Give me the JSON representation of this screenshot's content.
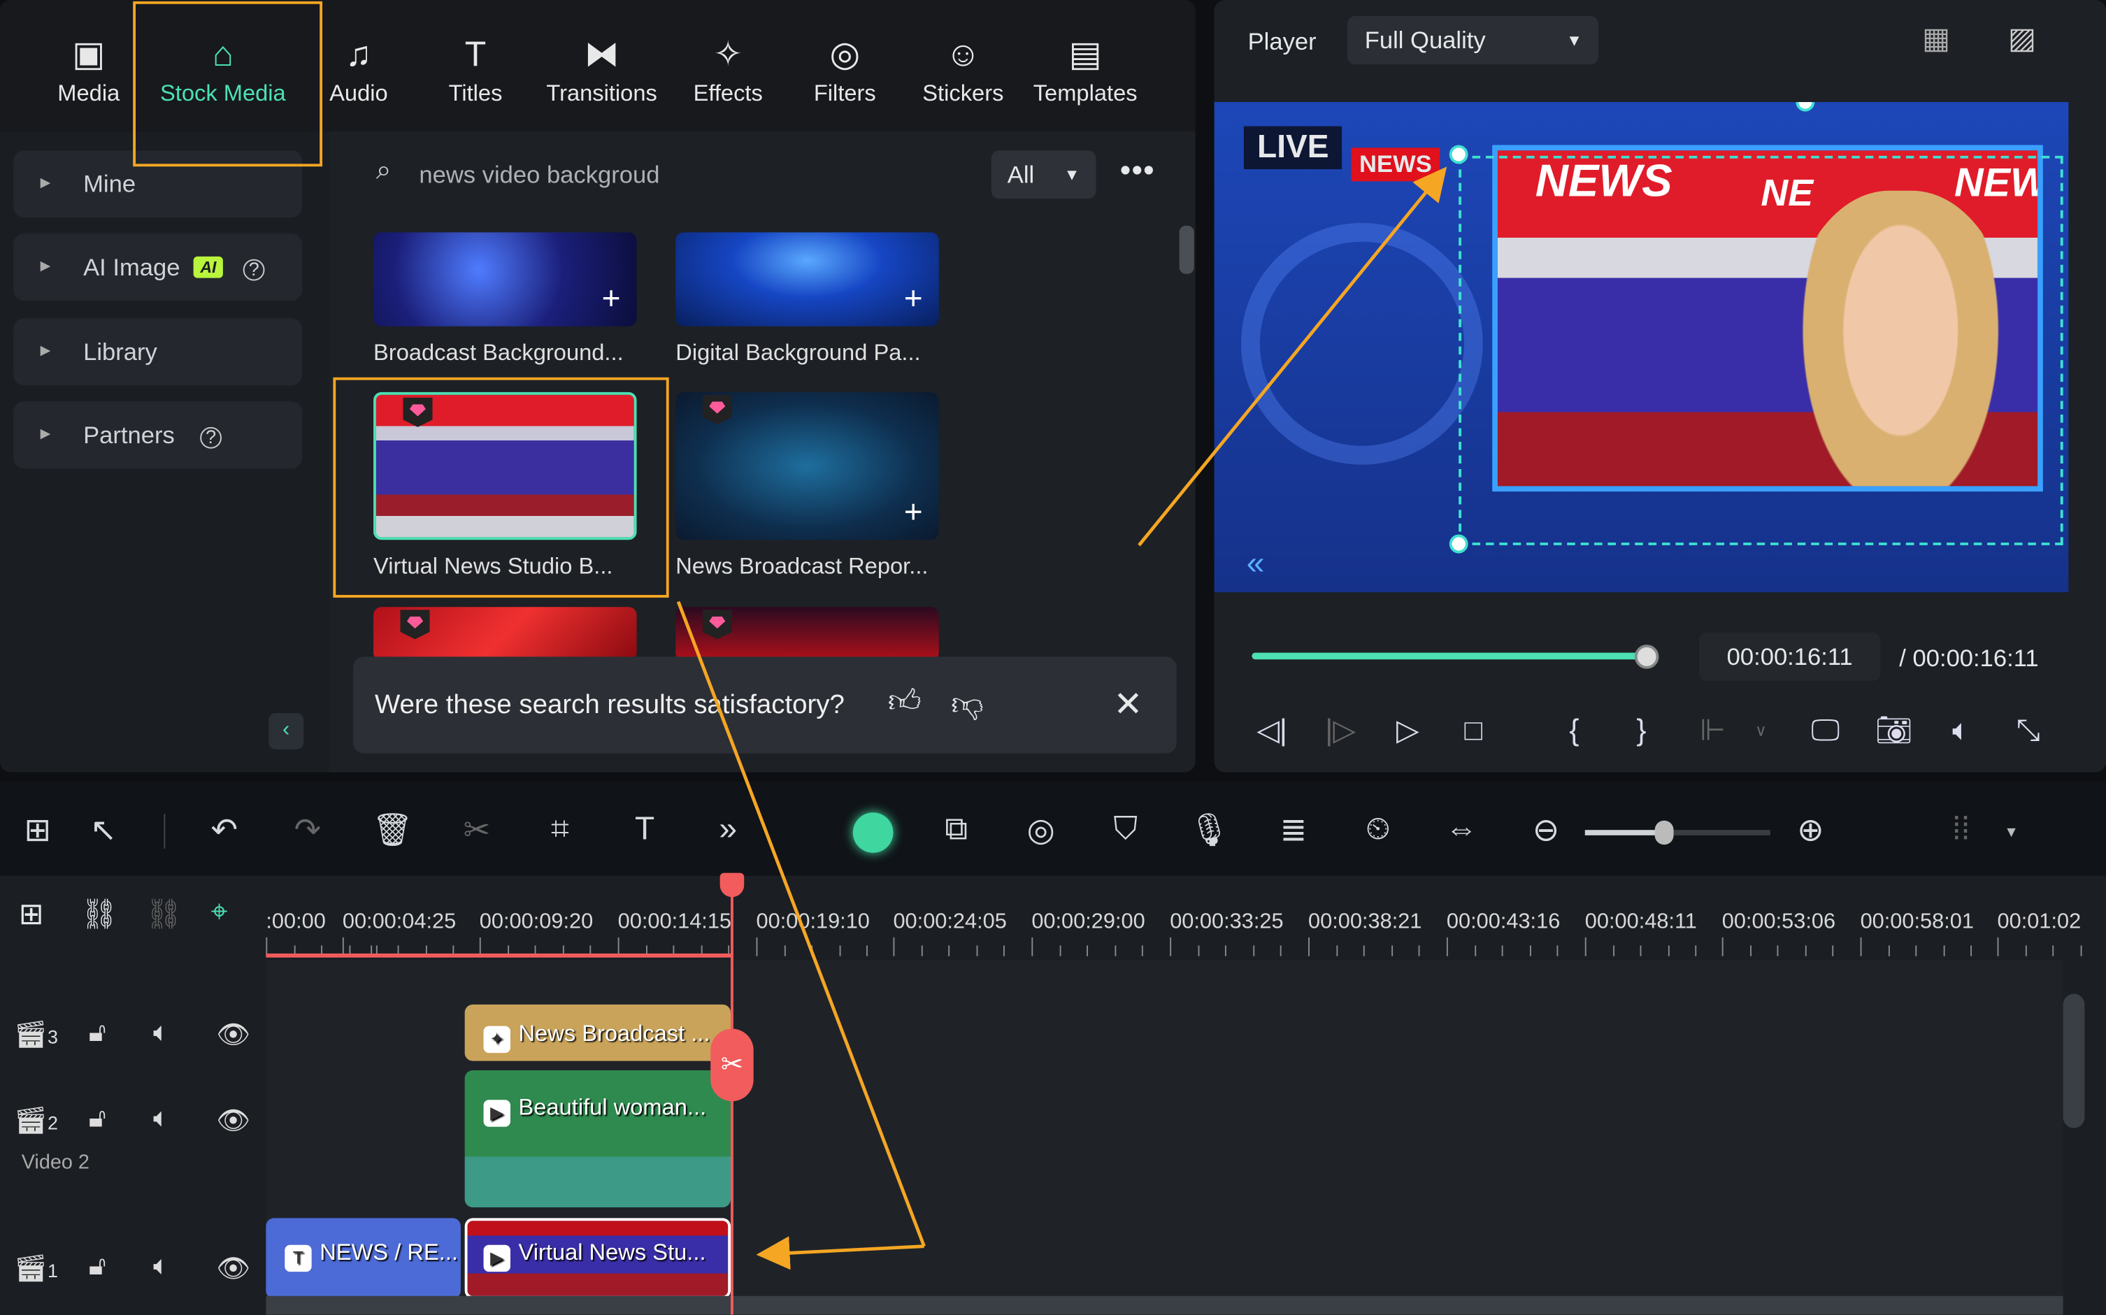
{
  "tabs": [
    {
      "label": "Media",
      "icon": "media-icon"
    },
    {
      "label": "Stock Media",
      "icon": "stock-media-icon",
      "active": true
    },
    {
      "label": "Audio",
      "icon": "music-note-icon"
    },
    {
      "label": "Titles",
      "icon": "text-icon"
    },
    {
      "label": "Transitions",
      "icon": "transitions-icon"
    },
    {
      "label": "Effects",
      "icon": "effects-icon"
    },
    {
      "label": "Filters",
      "icon": "filters-icon"
    },
    {
      "label": "Stickers",
      "icon": "stickers-icon"
    },
    {
      "label": "Templates",
      "icon": "templates-icon"
    }
  ],
  "sidebar": {
    "items": [
      {
        "label": "Mine"
      },
      {
        "label": "AI Image",
        "badge": "AI"
      },
      {
        "label": "Library"
      },
      {
        "label": "Partners"
      }
    ]
  },
  "search": {
    "value": "news video backgroud",
    "filter": "All"
  },
  "results": [
    {
      "title": "Broadcast Background..."
    },
    {
      "title": "Digital Background Pa..."
    },
    {
      "title": "Virtual News Studio B...",
      "premium": true,
      "selected": true
    },
    {
      "title": "News Broadcast Repor...",
      "premium": true
    }
  ],
  "feedback": {
    "question": "Were these search results satisfactory?"
  },
  "player": {
    "label": "Player",
    "quality": "Full Quality",
    "current_time": "00:00:16:11",
    "total_time": "/ 00:00:16:11",
    "progress": 1.0,
    "preview": {
      "live": "LIVE",
      "news_tag": "NEWS",
      "banner": "NEWS",
      "banner2": "NE",
      "banner3": "NEW"
    }
  },
  "timeline": {
    "ticks": [
      ":00:00",
      "00:00:04:25",
      "00:00:09:20",
      "00:00:14:15",
      "00:00:19:10",
      "00:00:24:05",
      "00:00:29:00",
      "00:00:33:25",
      "00:00:38:21",
      "00:00:43:16",
      "00:00:48:11",
      "00:00:53:06",
      "00:00:58:01",
      "00:01:02"
    ],
    "tracks": [
      {
        "num": "3"
      },
      {
        "num": "2",
        "name": "Video 2"
      },
      {
        "num": "1"
      }
    ],
    "clips": {
      "effect": "News Broadcast ...",
      "video2": "Beautiful woman...",
      "title": "NEWS / RE...",
      "video1": "Virtual News Stu..."
    }
  },
  "colors": {
    "accent": "#4de0b4",
    "highlight": "#f5a623",
    "playhead": "#f25c5c"
  }
}
